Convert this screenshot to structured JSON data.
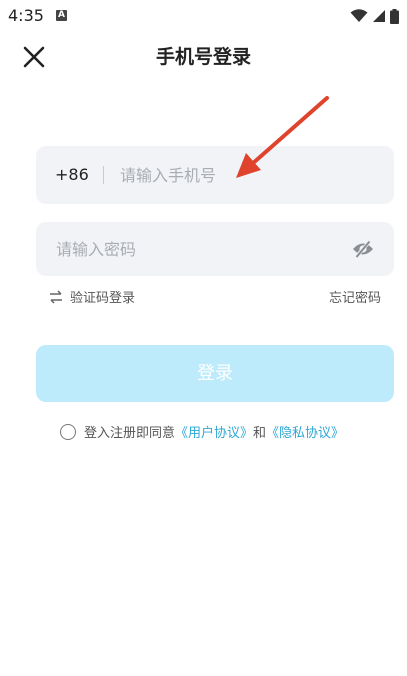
{
  "status_bar": {
    "time": "4:35",
    "notif_letter": "A"
  },
  "header": {
    "title": "手机号登录"
  },
  "phone": {
    "country_code": "+86",
    "placeholder": "请输入手机号"
  },
  "password": {
    "placeholder": "请输入密码"
  },
  "links": {
    "sms_login": "验证码登录",
    "forgot_password": "忘记密码"
  },
  "login_button": {
    "label": "登录"
  },
  "agreement": {
    "prefix": "登入注册即同意",
    "user_agreement": "《用户协议》",
    "and": "和",
    "privacy_policy": "《隐私协议》"
  },
  "colors": {
    "accent": "#2ea8d6",
    "login_button_bg": "#bdebfb",
    "input_bg": "#f1f3f6",
    "annotation_arrow": "#e0432c"
  }
}
